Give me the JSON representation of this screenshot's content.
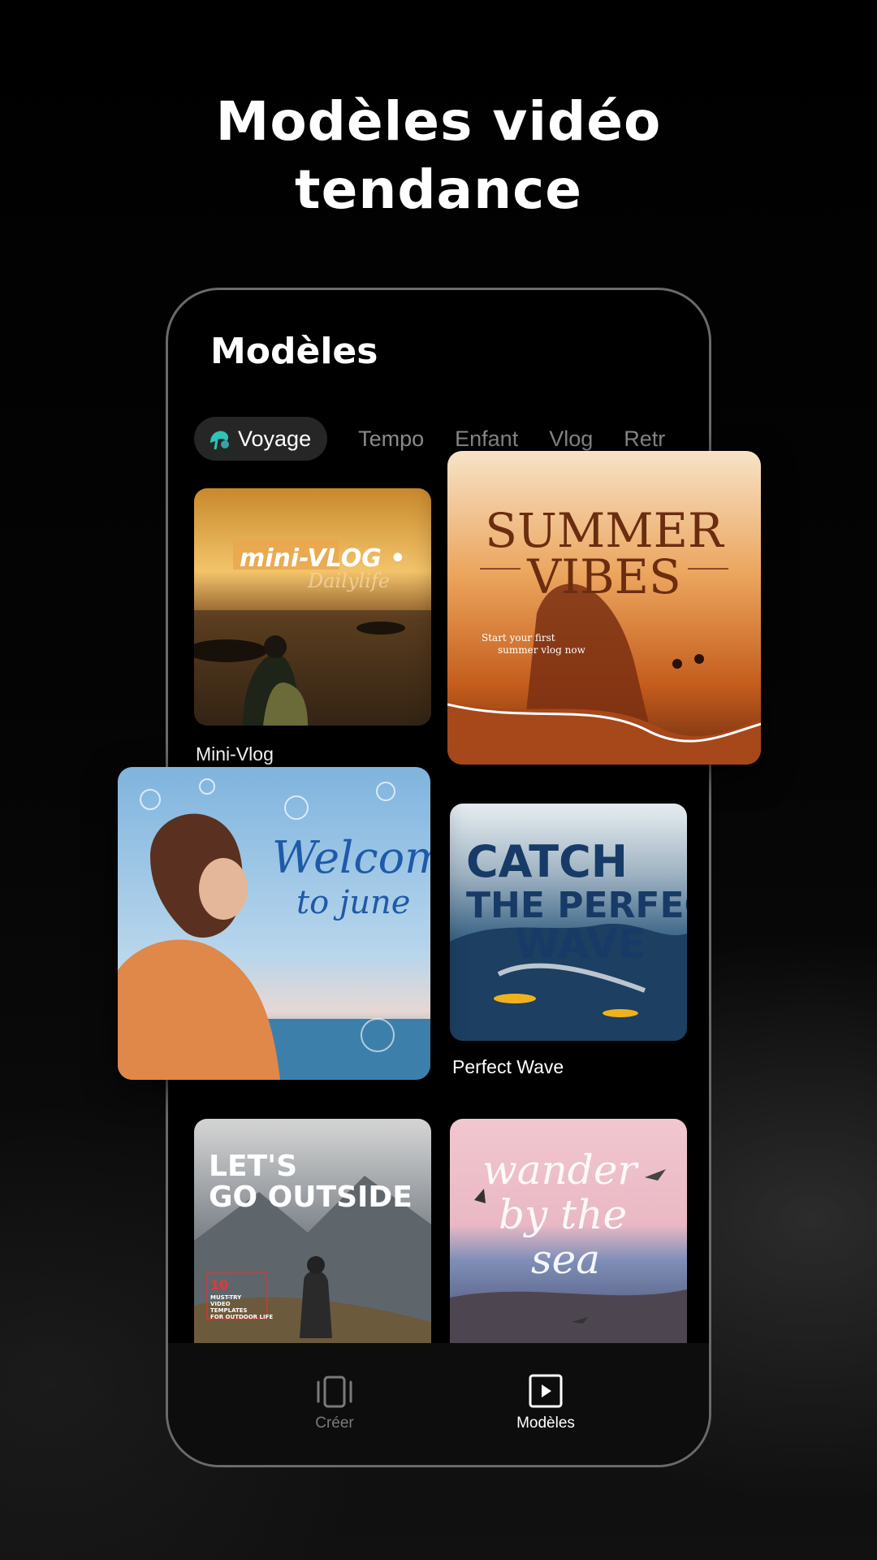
{
  "headline": {
    "line1": "Modèles vidéo",
    "line2": "tendance"
  },
  "screen": {
    "title": "Modèles",
    "tabs": [
      {
        "label": "Voyage",
        "active": true,
        "icon": "travel-icon"
      },
      {
        "label": "Tempo",
        "active": false
      },
      {
        "label": "Enfant",
        "active": false
      },
      {
        "label": "Vlog",
        "active": false
      },
      {
        "label": "Retr",
        "active": false
      }
    ],
    "cards": [
      {
        "label": "Mini-Vlog",
        "overlay": "mini-VLOG •",
        "overlay_script": "Dailylife"
      },
      {
        "label": "Perfect Wave",
        "overlay_lines": [
          "CATCH",
          "THE PERFECT",
          "WAVE"
        ]
      },
      {
        "overlay_lines": [
          "LET'S",
          "GO OUTSIDE"
        ],
        "note_number": "10",
        "note_lines": [
          "MUST-TRY",
          "VIDEO",
          "TEMPLATES",
          "FOR OUTDOOR LIFE"
        ]
      },
      {
        "overlay_lines": [
          "wander",
          "by the",
          "sea"
        ]
      }
    ],
    "floating_cards": [
      {
        "title_lines": [
          "SUMMER",
          "VIBES"
        ],
        "subtitle_lines": [
          "Start your first",
          "summer vlog now"
        ]
      },
      {
        "title_lines": [
          "Welcome",
          "to june"
        ]
      }
    ]
  },
  "nav": {
    "items": [
      {
        "label": "Créer",
        "icon": "create-icon",
        "active": false
      },
      {
        "label": "Modèles",
        "icon": "play-square-icon",
        "active": true
      }
    ]
  },
  "colors": {
    "background": "#000000",
    "accent_teal": "#2ec4b6",
    "inactive": "#8a8a8a"
  }
}
